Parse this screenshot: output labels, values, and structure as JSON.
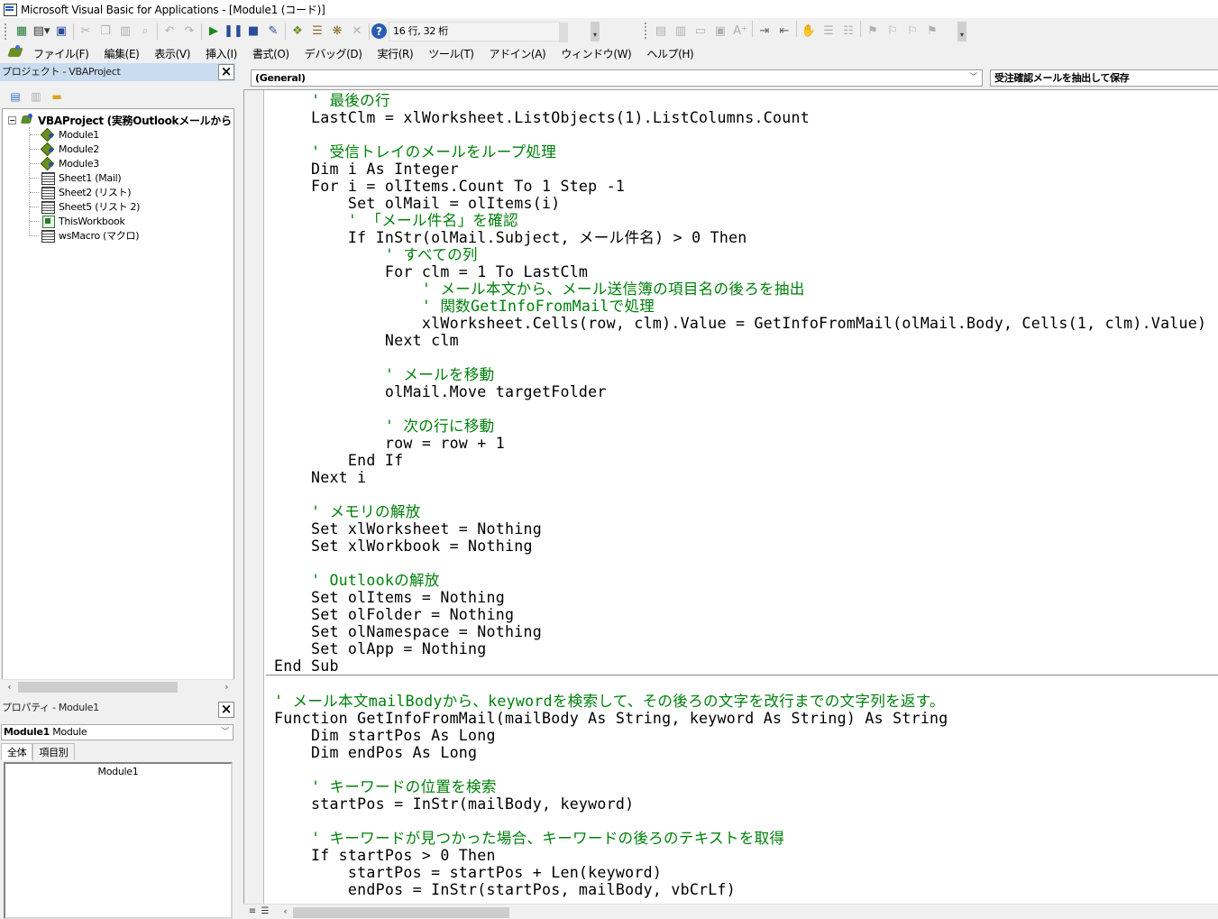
{
  "window": {
    "title": "Microsoft Visual Basic for Applications - [Module1 (コード)]"
  },
  "toolbar": {
    "cursor_position": "16 行, 32 桁"
  },
  "menu": {
    "items": [
      "ファイル(F)",
      "編集(E)",
      "表示(V)",
      "挿入(I)",
      "書式(O)",
      "デバッグ(D)",
      "実行(R)",
      "ツール(T)",
      "アドイン(A)",
      "ウィンドウ(W)",
      "ヘルプ(H)"
    ]
  },
  "project_pane": {
    "title": "プロジェクト - VBAProject",
    "root": "VBAProject (実務Outlookメールから Ex",
    "items": [
      {
        "label": "Module1",
        "icon": "module-icon"
      },
      {
        "label": "Module2",
        "icon": "module-icon"
      },
      {
        "label": "Module3",
        "icon": "module-icon"
      },
      {
        "label": "Sheet1 (Mail)",
        "icon": "sheet-icon"
      },
      {
        "label": "Sheet2 (リスト)",
        "icon": "sheet-icon"
      },
      {
        "label": "Sheet5 (リスト 2)",
        "icon": "sheet-icon"
      },
      {
        "label": "ThisWorkbook",
        "icon": "workbook-icon"
      },
      {
        "label": "wsMacro (マクロ)",
        "icon": "sheet-icon"
      }
    ]
  },
  "properties_pane": {
    "title": "プロパティ - Module1",
    "object_name": "Module1",
    "object_type": "Module",
    "tabs": [
      "全体",
      "項目別"
    ],
    "rows": [
      "Module1"
    ]
  },
  "code_window": {
    "object_combo": "(General)",
    "procedure_combo": "受注確認メールを抽出して保存",
    "lines": [
      {
        "text": "    ' 最後の行",
        "comment": true
      },
      {
        "text": "    LastClm = xlWorksheet.ListObjects(1).ListColumns.Count",
        "comment": false
      },
      {
        "text": "",
        "comment": false
      },
      {
        "text": "    ' 受信トレイのメールをループ処理",
        "comment": true
      },
      {
        "text": "    Dim i As Integer",
        "comment": false
      },
      {
        "text": "    For i = olItems.Count To 1 Step -1",
        "comment": false
      },
      {
        "text": "        Set olMail = olItems(i)",
        "comment": false
      },
      {
        "text": "        ' 「メール件名」を確認",
        "comment": true
      },
      {
        "text": "        If InStr(olMail.Subject, メール件名) > 0 Then",
        "comment": false
      },
      {
        "text": "            ' すべての列",
        "comment": true
      },
      {
        "text": "            For clm = 1 To LastClm",
        "comment": false
      },
      {
        "text": "                ' メール本文から、メール送信簿の項目名の後ろを抽出",
        "comment": true
      },
      {
        "text": "                ' 関数GetInfoFromMailで処理",
        "comment": true
      },
      {
        "text": "                xlWorksheet.Cells(row, clm).Value = GetInfoFromMail(olMail.Body, Cells(1, clm).Value)",
        "comment": false
      },
      {
        "text": "            Next clm",
        "comment": false
      },
      {
        "text": "",
        "comment": false
      },
      {
        "text": "            ' メールを移動",
        "comment": true
      },
      {
        "text": "            olMail.Move targetFolder",
        "comment": false
      },
      {
        "text": "",
        "comment": false
      },
      {
        "text": "            ' 次の行に移動",
        "comment": true
      },
      {
        "text": "            row = row + 1",
        "comment": false
      },
      {
        "text": "        End If",
        "comment": false
      },
      {
        "text": "    Next i",
        "comment": false
      },
      {
        "text": "",
        "comment": false
      },
      {
        "text": "    ' メモリの解放",
        "comment": true
      },
      {
        "text": "    Set xlWorksheet = Nothing",
        "comment": false
      },
      {
        "text": "    Set xlWorkbook = Nothing",
        "comment": false
      },
      {
        "text": "",
        "comment": false
      },
      {
        "text": "    ' Outlookの解放",
        "comment": true
      },
      {
        "text": "    Set olItems = Nothing",
        "comment": false
      },
      {
        "text": "    Set olFolder = Nothing",
        "comment": false
      },
      {
        "text": "    Set olNamespace = Nothing",
        "comment": false
      },
      {
        "text": "    Set olApp = Nothing",
        "comment": false
      },
      {
        "text": "End Sub",
        "comment": false
      },
      {
        "text": "",
        "comment": false
      },
      {
        "text": "' メール本文mailBodyから、keywordを検索して、その後ろの文字を改行までの文字列を返す。",
        "comment": true
      },
      {
        "text": "Function GetInfoFromMail(mailBody As String, keyword As String) As String",
        "comment": false
      },
      {
        "text": "    Dim startPos As Long",
        "comment": false
      },
      {
        "text": "    Dim endPos As Long",
        "comment": false
      },
      {
        "text": "",
        "comment": false
      },
      {
        "text": "    ' キーワードの位置を検索",
        "comment": true
      },
      {
        "text": "    startPos = InStr(mailBody, keyword)",
        "comment": false
      },
      {
        "text": "",
        "comment": false
      },
      {
        "text": "    ' キーワードが見つかった場合、キーワードの後ろのテキストを取得",
        "comment": true
      },
      {
        "text": "    If startPos > 0 Then",
        "comment": false
      },
      {
        "text": "        startPos = startPos + Len(keyword)",
        "comment": false
      },
      {
        "text": "        endPos = InStr(startPos, mailBody, vbCrLf)",
        "comment": false
      }
    ]
  },
  "colors": {
    "comment": "#00800b",
    "pane_title_active": "#c9dcf0",
    "chrome": "#f0f0f0"
  }
}
